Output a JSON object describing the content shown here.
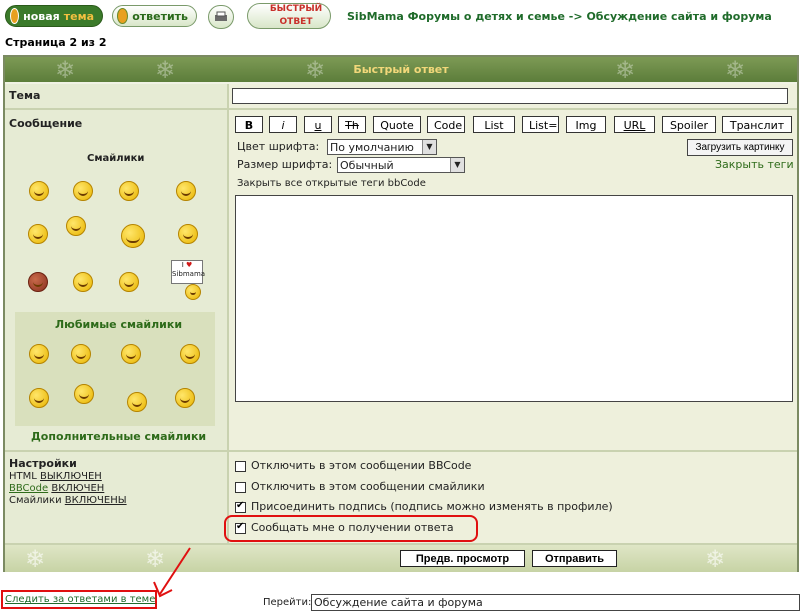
{
  "toolbar": {
    "new_topic_prefix": "новая",
    "new_topic_word": "тема",
    "reply": "ответить",
    "quick_reply_line1": "БЫСТРЫЙ",
    "quick_reply_line2": "ОТВЕТ"
  },
  "breadcrumb": {
    "forum": "SibMama Форумы о детях и семье",
    "sep": "->",
    "section": "Обсуждение сайта и форума"
  },
  "pages": "Страница 2 из 2",
  "form": {
    "header": "Быстрый ответ",
    "topic_label": "Тема",
    "topic_value": "",
    "message_label": "Сообщение",
    "smilies_title": "Смайлики",
    "fav_smilies_title": "Любимые смайлики",
    "more_smilies": "Дополнительные смайлики",
    "smilies_sign_text": "Sibmama",
    "bbcode_buttons": [
      "B",
      "i",
      "u",
      "Th",
      "Quote",
      "Code",
      "List",
      "List=",
      "Img",
      "URL",
      "Spoiler",
      "Транслит"
    ],
    "font_color_label": "Цвет шрифта:",
    "font_color_value": "По умолчанию",
    "font_size_label": "Размер шрифта:",
    "font_size_value": "Обычный",
    "upload_image": "Загрузить картинку",
    "close_tags": "Закрыть теги",
    "close_all_tags": "Закрыть все открытые теги bbCode",
    "message_value": "",
    "settings_label": "Настройки",
    "html_label": "HTML",
    "html_state": "ВЫКЛЮЧЕН",
    "bbcode_label": "BBCode",
    "bbcode_state": "ВКЛЮЧЕН",
    "smilies_label": "Смайлики",
    "smilies_state": "ВКЛЮЧЕНЫ",
    "options": [
      {
        "label": "Отключить в этом сообщении BBCode",
        "checked": false
      },
      {
        "label": "Отключить в этом сообщении смайлики",
        "checked": false
      },
      {
        "label": "Присоединить подпись (подпись можно изменять в профиле)",
        "checked": true
      },
      {
        "label": "Сообщать мне о получении ответа",
        "checked": true
      }
    ],
    "preview": "Предв. просмотр",
    "submit": "Отправить"
  },
  "footer": {
    "watch_link": "Следить за ответами в теме",
    "jump_label": "Перейти:",
    "jump_value": "Обсуждение сайта и форума"
  },
  "colors": {
    "header_green": "#5c7d3a",
    "header_text": "#f2d87a",
    "highlight_red": "#e01010",
    "panel": "#eef0dc"
  }
}
